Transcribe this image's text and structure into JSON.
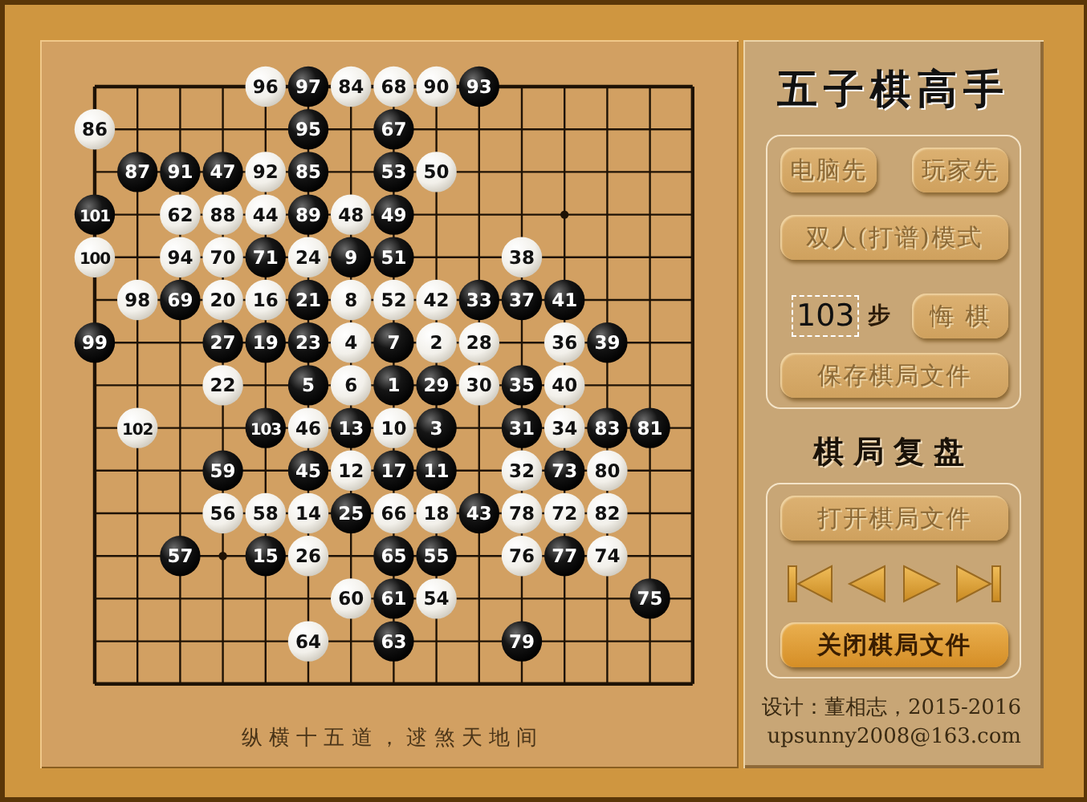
{
  "title": "五子棋高手",
  "board": [
    [
      {
        "kind": "empty"
      },
      {
        "kind": "empty"
      },
      {
        "kind": "empty"
      },
      {
        "kind": "empty"
      },
      {
        "number": "96",
        "kind": "white"
      },
      {
        "number": "97",
        "kind": "black"
      },
      {
        "number": "84",
        "kind": "white"
      },
      {
        "number": "68",
        "kind": "white"
      },
      {
        "number": "90",
        "kind": "white"
      },
      {
        "number": "93",
        "kind": "black"
      },
      {
        "kind": "empty"
      },
      {
        "kind": "empty"
      },
      {
        "kind": "empty"
      },
      {
        "kind": "empty"
      },
      {
        "kind": "empty"
      }
    ],
    [
      {
        "number": "86",
        "kind": "white"
      },
      {
        "kind": "empty"
      },
      {
        "kind": "empty"
      },
      {
        "kind": "empty"
      },
      {
        "kind": "empty"
      },
      {
        "number": "95",
        "kind": "black"
      },
      {
        "kind": "empty"
      },
      {
        "number": "67",
        "kind": "black"
      },
      {
        "kind": "empty"
      },
      {
        "kind": "empty"
      },
      {
        "kind": "empty"
      },
      {
        "kind": "empty"
      },
      {
        "kind": "empty"
      },
      {
        "kind": "empty"
      },
      {
        "kind": "empty"
      }
    ],
    [
      {
        "kind": "empty"
      },
      {
        "number": "87",
        "kind": "black"
      },
      {
        "number": "91",
        "kind": "black"
      },
      {
        "number": "47",
        "kind": "black"
      },
      {
        "number": "92",
        "kind": "white"
      },
      {
        "number": "85",
        "kind": "black"
      },
      {
        "kind": "empty"
      },
      {
        "number": "53",
        "kind": "black"
      },
      {
        "number": "50",
        "kind": "white"
      },
      {
        "kind": "empty"
      },
      {
        "kind": "empty"
      },
      {
        "kind": "empty"
      },
      {
        "kind": "empty"
      },
      {
        "kind": "empty"
      },
      {
        "kind": "empty"
      }
    ],
    [
      {
        "number": "101",
        "kind": "black"
      },
      {
        "kind": "empty"
      },
      {
        "number": "62",
        "kind": "white"
      },
      {
        "number": "88",
        "kind": "white"
      },
      {
        "number": "44",
        "kind": "white"
      },
      {
        "number": "89",
        "kind": "black"
      },
      {
        "number": "48",
        "kind": "white"
      },
      {
        "number": "49",
        "kind": "black"
      },
      {
        "kind": "empty"
      },
      {
        "kind": "empty"
      },
      {
        "kind": "empty"
      },
      {
        "kind": "empty"
      },
      {
        "kind": "empty"
      },
      {
        "kind": "empty"
      },
      {
        "kind": "empty"
      }
    ],
    [
      {
        "number": "100",
        "kind": "white"
      },
      {
        "kind": "empty"
      },
      {
        "number": "94",
        "kind": "white"
      },
      {
        "number": "70",
        "kind": "white"
      },
      {
        "number": "71",
        "kind": "black"
      },
      {
        "number": "24",
        "kind": "white"
      },
      {
        "number": "9",
        "kind": "black"
      },
      {
        "number": "51",
        "kind": "black"
      },
      {
        "kind": "empty"
      },
      {
        "kind": "empty"
      },
      {
        "number": "38",
        "kind": "white"
      },
      {
        "kind": "empty"
      },
      {
        "kind": "empty"
      },
      {
        "kind": "empty"
      },
      {
        "kind": "empty"
      }
    ],
    [
      {
        "kind": "empty"
      },
      {
        "number": "98",
        "kind": "white"
      },
      {
        "number": "69",
        "kind": "black"
      },
      {
        "number": "20",
        "kind": "white"
      },
      {
        "number": "16",
        "kind": "white"
      },
      {
        "number": "21",
        "kind": "black"
      },
      {
        "number": "8",
        "kind": "white"
      },
      {
        "number": "52",
        "kind": "white"
      },
      {
        "number": "42",
        "kind": "white"
      },
      {
        "number": "33",
        "kind": "black"
      },
      {
        "number": "37",
        "kind": "black"
      },
      {
        "number": "41",
        "kind": "black"
      },
      {
        "kind": "empty"
      },
      {
        "kind": "empty"
      },
      {
        "kind": "empty"
      }
    ],
    [
      {
        "number": "99",
        "kind": "black"
      },
      {
        "kind": "empty"
      },
      {
        "kind": "empty"
      },
      {
        "number": "27",
        "kind": "black"
      },
      {
        "number": "19",
        "kind": "black"
      },
      {
        "number": "23",
        "kind": "black"
      },
      {
        "number": "4",
        "kind": "white"
      },
      {
        "number": "7",
        "kind": "black"
      },
      {
        "number": "2",
        "kind": "white"
      },
      {
        "number": "28",
        "kind": "white"
      },
      {
        "kind": "empty"
      },
      {
        "number": "36",
        "kind": "white"
      },
      {
        "number": "39",
        "kind": "black"
      },
      {
        "kind": "empty"
      },
      {
        "kind": "empty"
      }
    ],
    [
      {
        "kind": "empty"
      },
      {
        "kind": "empty"
      },
      {
        "kind": "empty"
      },
      {
        "number": "22",
        "kind": "white"
      },
      {
        "kind": "empty"
      },
      {
        "number": "5",
        "kind": "black"
      },
      {
        "number": "6",
        "kind": "white"
      },
      {
        "number": "1",
        "kind": "black"
      },
      {
        "number": "29",
        "kind": "black"
      },
      {
        "number": "30",
        "kind": "white"
      },
      {
        "number": "35",
        "kind": "black"
      },
      {
        "number": "40",
        "kind": "white"
      },
      {
        "kind": "empty"
      },
      {
        "kind": "empty"
      },
      {
        "kind": "empty"
      }
    ],
    [
      {
        "kind": "empty"
      },
      {
        "number": "102",
        "kind": "white"
      },
      {
        "kind": "empty"
      },
      {
        "kind": "empty"
      },
      {
        "number": "103",
        "kind": "black"
      },
      {
        "number": "46",
        "kind": "white"
      },
      {
        "number": "13",
        "kind": "black"
      },
      {
        "number": "10",
        "kind": "white"
      },
      {
        "number": "3",
        "kind": "black"
      },
      {
        "kind": "empty"
      },
      {
        "number": "31",
        "kind": "black"
      },
      {
        "number": "34",
        "kind": "white"
      },
      {
        "number": "83",
        "kind": "black"
      },
      {
        "number": "81",
        "kind": "black"
      },
      {
        "kind": "empty"
      }
    ],
    [
      {
        "kind": "empty"
      },
      {
        "kind": "empty"
      },
      {
        "kind": "empty"
      },
      {
        "number": "59",
        "kind": "black"
      },
      {
        "kind": "empty"
      },
      {
        "number": "45",
        "kind": "black"
      },
      {
        "number": "12",
        "kind": "white"
      },
      {
        "number": "17",
        "kind": "black"
      },
      {
        "number": "11",
        "kind": "black"
      },
      {
        "kind": "empty"
      },
      {
        "number": "32",
        "kind": "white"
      },
      {
        "number": "73",
        "kind": "black"
      },
      {
        "number": "80",
        "kind": "white"
      },
      {
        "kind": "empty"
      },
      {
        "kind": "empty"
      }
    ],
    [
      {
        "kind": "empty"
      },
      {
        "kind": "empty"
      },
      {
        "kind": "empty"
      },
      {
        "number": "56",
        "kind": "white"
      },
      {
        "number": "58",
        "kind": "white"
      },
      {
        "number": "14",
        "kind": "white"
      },
      {
        "number": "25",
        "kind": "black"
      },
      {
        "number": "66",
        "kind": "white"
      },
      {
        "number": "18",
        "kind": "white"
      },
      {
        "number": "43",
        "kind": "black"
      },
      {
        "number": "78",
        "kind": "white"
      },
      {
        "number": "72",
        "kind": "white"
      },
      {
        "number": "82",
        "kind": "white"
      },
      {
        "kind": "empty"
      },
      {
        "kind": "empty"
      }
    ],
    [
      {
        "kind": "empty"
      },
      {
        "kind": "empty"
      },
      {
        "number": "57",
        "kind": "black"
      },
      {
        "kind": "empty"
      },
      {
        "number": "15",
        "kind": "black"
      },
      {
        "number": "26",
        "kind": "white"
      },
      {
        "kind": "empty"
      },
      {
        "number": "65",
        "kind": "black"
      },
      {
        "number": "55",
        "kind": "black"
      },
      {
        "kind": "empty"
      },
      {
        "number": "76",
        "kind": "white"
      },
      {
        "number": "77",
        "kind": "black"
      },
      {
        "number": "74",
        "kind": "white"
      },
      {
        "kind": "empty"
      },
      {
        "kind": "empty"
      }
    ],
    [
      {
        "kind": "empty"
      },
      {
        "kind": "empty"
      },
      {
        "kind": "empty"
      },
      {
        "kind": "empty"
      },
      {
        "kind": "empty"
      },
      {
        "kind": "empty"
      },
      {
        "number": "60",
        "kind": "white"
      },
      {
        "number": "61",
        "kind": "black"
      },
      {
        "number": "54",
        "kind": "white"
      },
      {
        "kind": "empty"
      },
      {
        "kind": "empty"
      },
      {
        "kind": "empty"
      },
      {
        "kind": "empty"
      },
      {
        "number": "75",
        "kind": "black"
      },
      {
        "kind": "empty"
      }
    ],
    [
      {
        "kind": "empty"
      },
      {
        "kind": "empty"
      },
      {
        "kind": "empty"
      },
      {
        "kind": "empty"
      },
      {
        "kind": "empty"
      },
      {
        "number": "64",
        "kind": "white"
      },
      {
        "kind": "empty"
      },
      {
        "number": "63",
        "kind": "black"
      },
      {
        "kind": "empty"
      },
      {
        "kind": "empty"
      },
      {
        "number": "79",
        "kind": "black"
      },
      {
        "kind": "empty"
      },
      {
        "kind": "empty"
      },
      {
        "kind": "empty"
      },
      {
        "kind": "empty"
      }
    ],
    [
      {
        "kind": "empty"
      },
      {
        "kind": "empty"
      },
      {
        "kind": "empty"
      },
      {
        "kind": "empty"
      },
      {
        "kind": "empty"
      },
      {
        "kind": "empty"
      },
      {
        "kind": "empty"
      },
      {
        "kind": "empty"
      },
      {
        "kind": "empty"
      },
      {
        "kind": "empty"
      },
      {
        "kind": "empty"
      },
      {
        "kind": "empty"
      },
      {
        "kind": "empty"
      },
      {
        "kind": "empty"
      },
      {
        "kind": "empty"
      }
    ]
  ],
  "caption": "纵 横 十 五 道 ， 逑 煞 天 地 间",
  "mode_buttons": [
    {
      "label": "电脑先",
      "disabled": true
    },
    {
      "label": "玩家先",
      "disabled": true
    }
  ],
  "pair_button": {
    "label": "双人(打谱)模式",
    "disabled": true
  },
  "move_count": "103",
  "move_unit": "步",
  "undo_button": {
    "label": "悔 棋",
    "disabled": true
  },
  "save_button": {
    "label": "保存棋局文件",
    "disabled": true
  },
  "replay_title": "棋局复盘",
  "open_button": {
    "label": "打开棋局文件",
    "disabled": true
  },
  "nav_buttons": [
    {
      "kind": "first"
    },
    {
      "kind": "prev"
    },
    {
      "kind": "next"
    },
    {
      "kind": "last"
    }
  ],
  "close_button": {
    "label": "关闭棋局文件",
    "disabled": false
  },
  "credits": [
    "设计：董相志，2015-2016",
    "upsunny2008@163.com"
  ]
}
